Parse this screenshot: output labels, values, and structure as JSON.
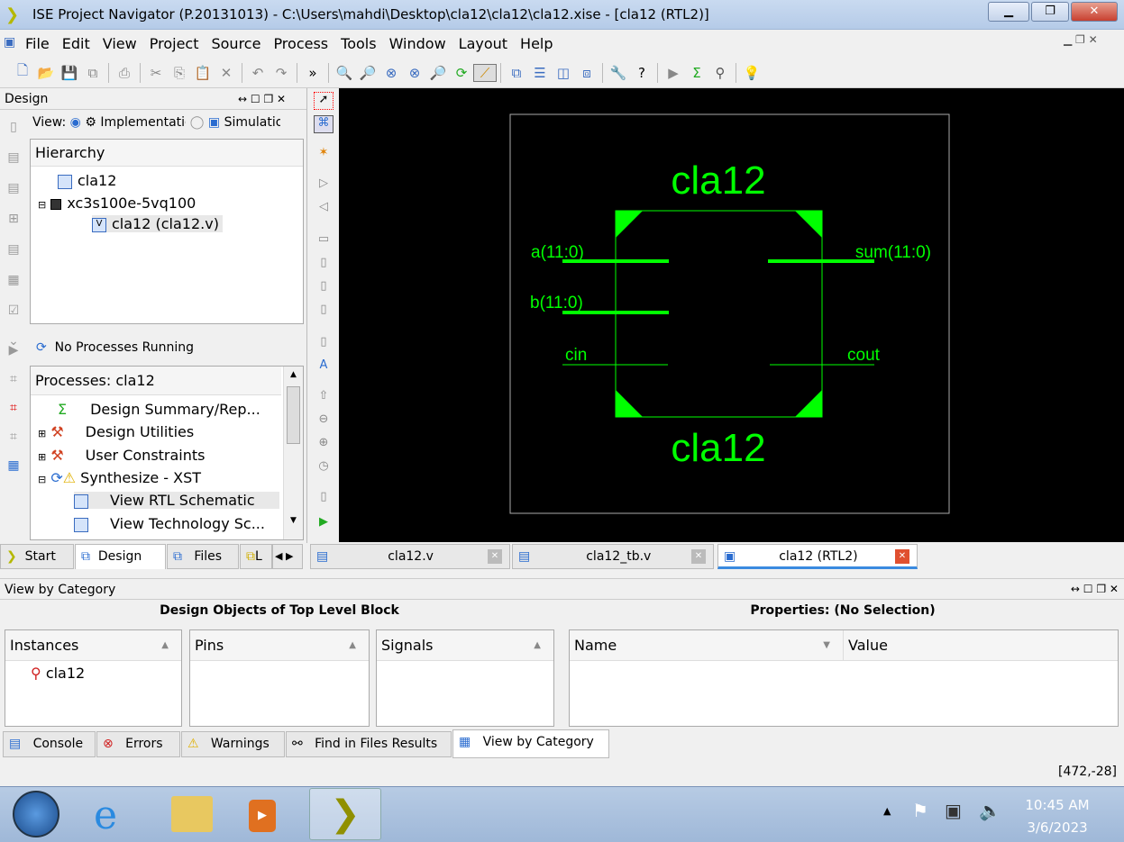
{
  "window": {
    "title": "ISE Project Navigator (P.20131013) - C:\\Users\\mahdi\\Desktop\\cla12\\cla12\\cla12.xise - [cla12 (RTL2)]"
  },
  "menu": [
    "File",
    "Edit",
    "View",
    "Project",
    "Source",
    "Process",
    "Tools",
    "Window",
    "Layout",
    "Help"
  ],
  "design_panel": {
    "title": "Design",
    "view_label": "View:",
    "view_options": [
      "Implementation",
      "Simulation"
    ],
    "hierarchy_header": "Hierarchy",
    "tree": [
      "cla12",
      "xc3s100e-5vq100",
      "cla12 (cla12.v)"
    ]
  },
  "processes": {
    "status": "No Processes Running",
    "header": "Processes: cla12",
    "items": [
      "Design Summary/Rep...",
      "Design Utilities",
      "User Constraints",
      "Synthesize - XST",
      "View RTL Schematic",
      "View Technology Sc..."
    ]
  },
  "left_tabs": [
    "Start",
    "Design",
    "Files",
    "L"
  ],
  "doc_tabs": [
    "cla12.v",
    "cla12_tb.v",
    "cla12 (RTL2)"
  ],
  "schematic": {
    "name_top": "cla12",
    "name_bottom": "cla12",
    "inputs": [
      "a(11:0)",
      "b(11:0)",
      "cin"
    ],
    "outputs": [
      "sum(11:0)",
      "cout"
    ],
    "color": "#00ff00",
    "background": "#000000"
  },
  "bottom_panel": {
    "title": "View by Category",
    "left_heading": "Design Objects of Top Level Block",
    "right_heading": "Properties: (No Selection)",
    "columns": [
      "Instances",
      "Pins",
      "Signals"
    ],
    "instances": [
      "cla12"
    ],
    "prop_columns": [
      "Name",
      "Value"
    ]
  },
  "bottom_tabs": [
    "Console",
    "Errors",
    "Warnings",
    "Find in Files Results",
    "View by Category"
  ],
  "status": {
    "coords": "[472,-28]"
  },
  "taskbar": {
    "time": "10:45 AM",
    "date": "3/6/2023"
  }
}
